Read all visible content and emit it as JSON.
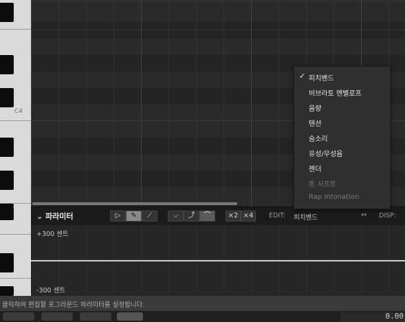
{
  "piano": {
    "note_label": "C4"
  },
  "param_header": {
    "title": "파라미터",
    "tools": [
      "select",
      "pencil",
      "line"
    ],
    "curve_tools": [
      "down",
      "smooth",
      "up"
    ],
    "zoom_labels": [
      "×2",
      "×4"
    ],
    "edit_label": "EDIT:",
    "edit_value": "피치벤드",
    "arrows": "↔",
    "disp_label": "DISP:"
  },
  "param_area": {
    "max_label": "+300 센트",
    "min_label": "-300 센트"
  },
  "status_bar": {
    "text": "클릭하여 편집할 포그라운드 파라미터를 설정합니다."
  },
  "bottom_bar": {
    "readout": "0.00"
  },
  "menu": {
    "checked_index": 0,
    "items": [
      {
        "label": "피치벤드",
        "enabled": true
      },
      {
        "label": "비브라토 엔벨로프",
        "enabled": true
      },
      {
        "label": "음량",
        "enabled": true
      },
      {
        "label": "텐션",
        "enabled": true
      },
      {
        "label": "숨소리",
        "enabled": true
      },
      {
        "label": "유성/무성음",
        "enabled": true
      },
      {
        "label": "젠더",
        "enabled": true
      },
      {
        "label": "톤 시프트",
        "enabled": false
      },
      {
        "label": "Rap Intonation",
        "enabled": false
      }
    ]
  }
}
